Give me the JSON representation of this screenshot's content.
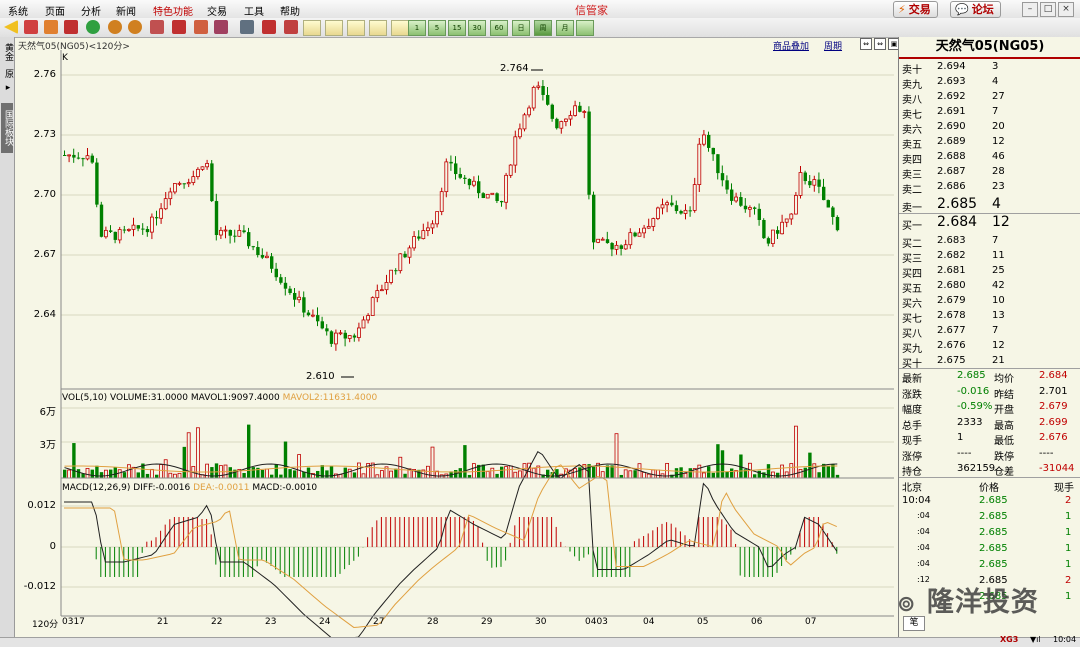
{
  "menu": [
    "系统",
    "页面",
    "分析",
    "新闻",
    "特色功能",
    "交易",
    "工具",
    "帮助"
  ],
  "app_title": "信管家",
  "top_buttons": {
    "trade": "交易",
    "forum": "论坛"
  },
  "toolbar_period_buttons": [
    "1",
    "5",
    "15",
    "30",
    "60",
    "日",
    "周",
    "月"
  ],
  "side_tabs": [
    "黄金",
    "原",
    "国际板块"
  ],
  "chart": {
    "header_info": "天然气05(NG05)<120分>",
    "k_label": "K",
    "links": [
      "商品叠加",
      "周期"
    ],
    "y_labels": [
      "2.76",
      "2.73",
      "2.70",
      "2.67",
      "2.64"
    ],
    "annot_high": "2.764",
    "annot_low": "2.610",
    "volume": {
      "label": "VOL(5,10)",
      "volume": "VOLUME:31.0000",
      "mavol1": "MAVOL1:9097.4000",
      "mavol2": "MAVOL2:11631.4000",
      "y_labels": [
        "6万",
        "3万"
      ]
    },
    "macd": {
      "label": "MACD(12,26,9)",
      "diff": "DIFF:-0.0016",
      "dea": "DEA:-0.0011",
      "macd": "MACD:-0.0010",
      "y_labels": [
        "0.012",
        "0",
        "-0.012"
      ]
    },
    "x_labels": [
      "120分",
      "0317",
      "21",
      "22",
      "23",
      "24",
      "27",
      "28",
      "29",
      "30",
      "0403",
      "04",
      "05",
      "06",
      "07"
    ]
  },
  "quote": {
    "title": "天然气05(NG05)",
    "asks": [
      {
        "label": "卖十",
        "price": "2.694",
        "vol": "3"
      },
      {
        "label": "卖九",
        "price": "2.693",
        "vol": "4"
      },
      {
        "label": "卖八",
        "price": "2.692",
        "vol": "27"
      },
      {
        "label": "卖七",
        "price": "2.691",
        "vol": "7"
      },
      {
        "label": "卖六",
        "price": "2.690",
        "vol": "20"
      },
      {
        "label": "卖五",
        "price": "2.689",
        "vol": "12"
      },
      {
        "label": "卖四",
        "price": "2.688",
        "vol": "46"
      },
      {
        "label": "卖三",
        "price": "2.687",
        "vol": "28"
      },
      {
        "label": "卖二",
        "price": "2.686",
        "vol": "23"
      },
      {
        "label": "卖一",
        "price": "2.685",
        "vol": "4"
      }
    ],
    "bids": [
      {
        "label": "买一",
        "price": "2.684",
        "vol": "12"
      },
      {
        "label": "买二",
        "price": "2.683",
        "vol": "7"
      },
      {
        "label": "买三",
        "price": "2.682",
        "vol": "11"
      },
      {
        "label": "买四",
        "price": "2.681",
        "vol": "25"
      },
      {
        "label": "买五",
        "price": "2.680",
        "vol": "42"
      },
      {
        "label": "买六",
        "price": "2.679",
        "vol": "10"
      },
      {
        "label": "买七",
        "price": "2.678",
        "vol": "13"
      },
      {
        "label": "买八",
        "price": "2.677",
        "vol": "7"
      },
      {
        "label": "买九",
        "price": "2.676",
        "vol": "12"
      },
      {
        "label": "买十",
        "price": "2.675",
        "vol": "21"
      }
    ],
    "stats": [
      [
        "最新",
        "2.685",
        "均价",
        "2.684"
      ],
      [
        "涨跌",
        "-0.016",
        "昨结",
        "2.701"
      ],
      [
        "幅度",
        "-0.59%",
        "开盘",
        "2.679"
      ],
      [
        "总手",
        "2333",
        "最高",
        "2.699"
      ],
      [
        "现手",
        "1",
        "最低",
        "2.676"
      ],
      [
        "涨停",
        "----",
        "跌停",
        "----"
      ],
      [
        "持仓",
        "362159",
        "仓差",
        "-31044"
      ]
    ],
    "trades_header": [
      "北京",
      "价格",
      "现手"
    ],
    "trades": [
      [
        "10:04",
        "2.685",
        "2"
      ],
      [
        ":04",
        "2.685",
        "1"
      ],
      [
        ":04",
        "2.685",
        "1"
      ],
      [
        ":04",
        "2.685",
        "1"
      ],
      [
        ":04",
        "2.685",
        "1"
      ],
      [
        ":12",
        "2.685",
        "2"
      ],
      [
        "",
        "2.685",
        "1"
      ]
    ],
    "bottom_tab": "笔"
  },
  "status": {
    "time": "10:04",
    "network": "XG3"
  },
  "watermark": "隆洋投资",
  "colors": {
    "up": "#c00000",
    "down": "#008000",
    "bg": "#f6f6e6"
  }
}
